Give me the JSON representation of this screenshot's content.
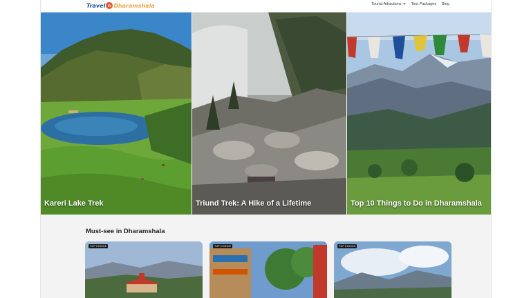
{
  "header": {
    "logo_part1": "Travel",
    "logo_mark": "n",
    "logo_part2": "Dharamshala",
    "nav": [
      {
        "label": "Tourist Attractions",
        "has_dropdown": true
      },
      {
        "label": "Tour Packages",
        "has_dropdown": false
      },
      {
        "label": "Blog",
        "has_dropdown": false
      }
    ]
  },
  "hero": {
    "tiles": [
      {
        "title": "Kareri Lake Trek"
      },
      {
        "title": "Triund Trek: A Hike of a Lifetime"
      },
      {
        "title": "Top 10 Things to Do in Dharamshala"
      }
    ]
  },
  "section": {
    "title": "Must-see in Dharamshala",
    "cards": [
      {
        "badge": "TOP CHOICE"
      },
      {
        "badge": "TOP CHOICE"
      },
      {
        "badge": "TOP CHOICE"
      }
    ]
  },
  "colors": {
    "logo_blue": "#1f4fa0",
    "logo_orange": "#f2a541",
    "logo_mark": "#e4572e",
    "section_bg": "#f3f3f3"
  }
}
